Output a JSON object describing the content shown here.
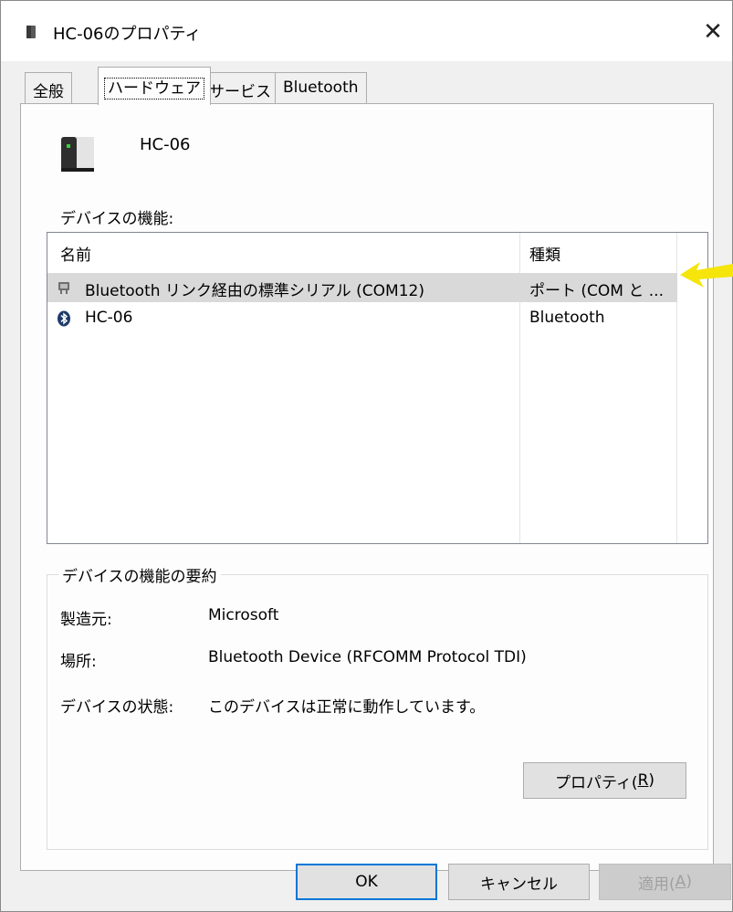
{
  "window": {
    "title": "HC-06のプロパティ",
    "close_glyph": "✕"
  },
  "tabs": [
    {
      "label": "全般",
      "active": false
    },
    {
      "label": "ハードウェア",
      "active": true
    },
    {
      "label": "サービス",
      "active": false
    },
    {
      "label": "Bluetooth",
      "active": false
    }
  ],
  "device": {
    "name": "HC-06",
    "icon": "device-icon"
  },
  "functions": {
    "label": "デバイスの機能:",
    "columns": [
      "名前",
      "種類"
    ],
    "rows": [
      {
        "name": "Bluetooth リンク経由の標準シリアル (COM12)",
        "type": "ポート (COM と ...",
        "icon": "port-icon",
        "selected": true
      },
      {
        "name": "HC-06",
        "type": "Bluetooth",
        "icon": "bluetooth-icon",
        "selected": false
      }
    ]
  },
  "summary": {
    "title": "デバイスの機能の要約",
    "manufacturer_label": "製造元:",
    "manufacturer_value": "Microsoft",
    "location_label": "場所:",
    "location_value": "Bluetooth Device (RFCOMM Protocol TDI)",
    "status_label": "デバイスの状態:",
    "status_value": "このデバイスは正常に動作しています。",
    "properties_button": "プロパティ(",
    "properties_key": "R",
    "properties_suffix": ")"
  },
  "footer": {
    "ok": "OK",
    "cancel": "キャンセル",
    "apply": "適用(",
    "apply_key": "A",
    "apply_suffix": ")"
  },
  "colors": {
    "accent": "#0078d7",
    "selection": "#d9d9d9",
    "annotation_arrow": "#f5e50a"
  }
}
